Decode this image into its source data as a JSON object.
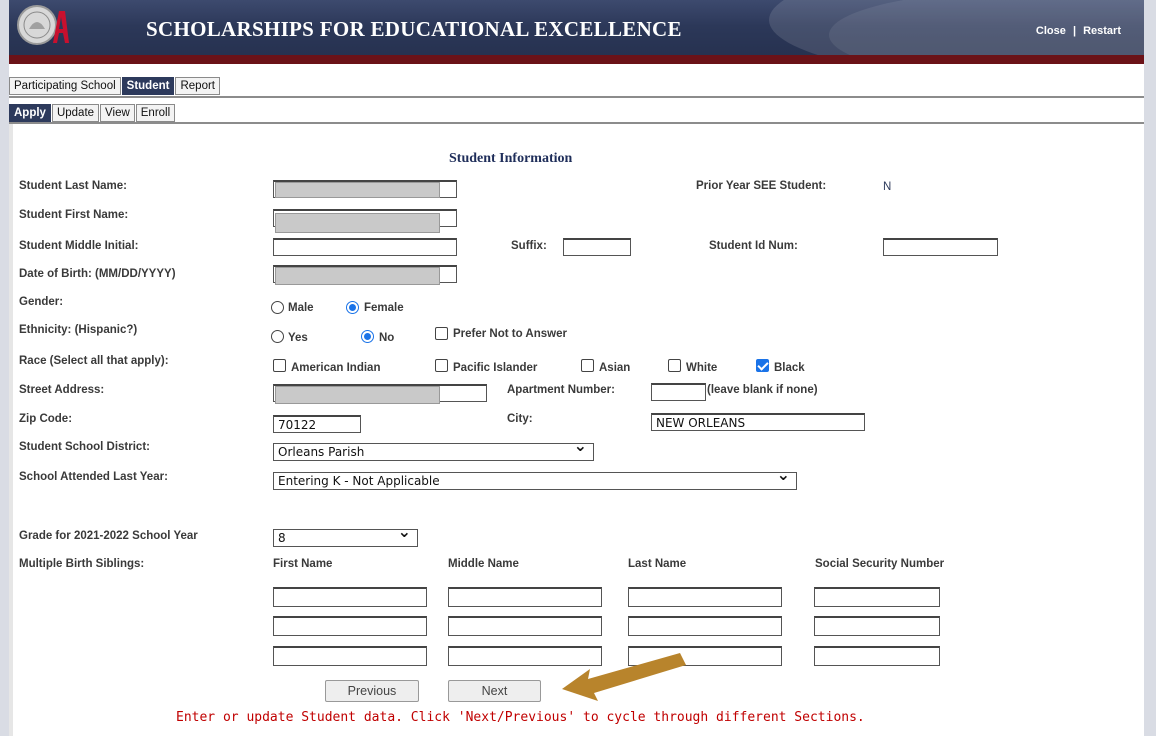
{
  "banner": {
    "title": "SCHOLARSHIPS FOR EDUCATIONAL EXCELLENCE",
    "close_label": "Close",
    "separator": "|",
    "restart_label": "Restart",
    "logo_text": "A+"
  },
  "tabs": {
    "main": [
      {
        "label": "Participating School",
        "active": false
      },
      {
        "label": "Student",
        "active": true
      },
      {
        "label": "Report",
        "active": false
      }
    ],
    "sub": [
      {
        "label": "Apply",
        "active": true
      },
      {
        "label": "Update",
        "active": false
      },
      {
        "label": "View",
        "active": false
      },
      {
        "label": "Enroll",
        "active": false
      }
    ]
  },
  "form": {
    "section_title": "Student Information",
    "labels": {
      "last_name": "Student Last Name:",
      "first_name": "Student First Name:",
      "middle_initial": "Student Middle Initial:",
      "dob": "Date of Birth: (MM/DD/YYYY)",
      "gender": "Gender:",
      "ethnicity": "Ethnicity: (Hispanic?)",
      "race": "Race (Select all that apply):",
      "street": "Street Address:",
      "zip": "Zip Code:",
      "district": "Student School District:",
      "school_last_year": "School Attended Last Year:",
      "grade": "Grade for 2021-2022 School Year",
      "siblings": "Multiple Birth Siblings:",
      "prior_year": "Prior Year SEE Student:",
      "suffix": "Suffix:",
      "student_id": "Student Id Num:",
      "apartment": "Apartment Number:",
      "apartment_hint": "(leave blank if none)",
      "city": "City:"
    },
    "prior_year_value": "N",
    "gender_options": [
      {
        "label": "Male",
        "selected": false
      },
      {
        "label": "Female",
        "selected": true
      }
    ],
    "ethnicity_options": [
      {
        "label": "Yes",
        "selected": false
      },
      {
        "label": "No",
        "selected": true
      }
    ],
    "ethnicity_prefer_not": {
      "label": "Prefer Not to Answer",
      "checked": false
    },
    "race_options": [
      {
        "label": "American Indian",
        "checked": false
      },
      {
        "label": "Pacific Islander",
        "checked": false
      },
      {
        "label": "Asian",
        "checked": false
      },
      {
        "label": "White",
        "checked": false
      },
      {
        "label": "Black",
        "checked": true
      }
    ],
    "values": {
      "middle_initial": "",
      "suffix": "",
      "student_id": "",
      "apartment": "",
      "zip": "70122",
      "city": "NEW ORLEANS",
      "district": "Orleans Parish",
      "school_last_year": "Entering K - Not Applicable",
      "grade": "8"
    },
    "sibling_headers": {
      "first": "First Name",
      "middle": "Middle Name",
      "last": "Last Name",
      "ssn": "Social Security Number"
    },
    "buttons": {
      "previous": "Previous",
      "next": "Next"
    },
    "status_message": "Enter or update Student data. Click 'Next/Previous' to cycle through different Sections."
  },
  "colors": {
    "banner": "#2c3859",
    "banner_stripe": "#6b1218",
    "accent": "#1a73e8",
    "status": "#c00000",
    "arrow": "#b8842c"
  }
}
